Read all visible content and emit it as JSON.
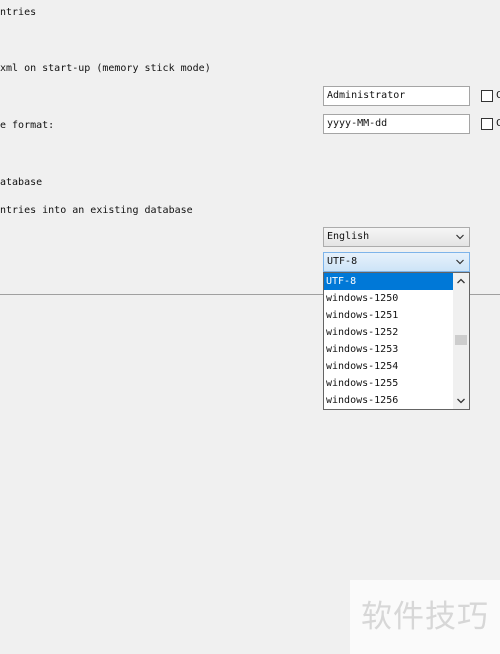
{
  "options": {
    "entries_label": "ntries",
    "startup_label": "xml on start-up (memory stick mode)",
    "username": {
      "value": "Administrator",
      "checkbox_text": "C"
    },
    "date_format": {
      "label": "e format:",
      "value": "yyyy-MM-dd",
      "checkbox_text": "C"
    },
    "database_label": "atabase",
    "import_label": "ntries into an existing database",
    "language": {
      "selected": "English"
    },
    "encoding": {
      "selected": "UTF-8",
      "options": [
        "UTF-8",
        "windows-1250",
        "windows-1251",
        "windows-1252",
        "windows-1253",
        "windows-1254",
        "windows-1255",
        "windows-1256"
      ],
      "highlighted_index": 0
    }
  },
  "icons": {
    "combo_arrow": "chevron-down-icon",
    "scroll_up": "scroll-up-arrow-icon",
    "scroll_down": "scroll-down-arrow-icon"
  },
  "watermark": {
    "text": "软件技巧"
  },
  "colors": {
    "selection": "#0078d7",
    "background": "#f0f0f0",
    "focus_border": "#7eb4ea"
  }
}
